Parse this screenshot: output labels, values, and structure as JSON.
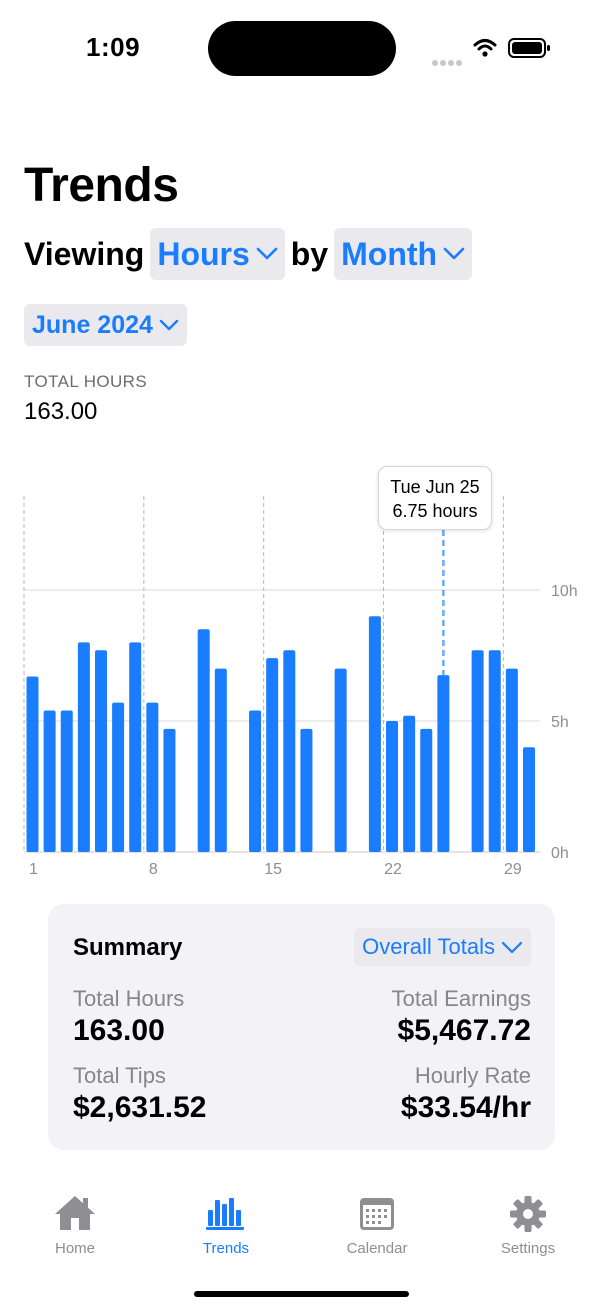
{
  "status_bar": {
    "time": "1:09"
  },
  "header": {
    "title": "Trends",
    "viewing_label": "Viewing",
    "metric": "Hours",
    "by_label": "by",
    "period": "Month",
    "selected_month": "June 2024"
  },
  "total": {
    "label": "TOTAL HOURS",
    "value": "163.00"
  },
  "chart_data": {
    "type": "bar",
    "x_label_ticks": [
      "1",
      "8",
      "15",
      "22",
      "29"
    ],
    "y_ticks": [
      "10h",
      "5h",
      "0h"
    ],
    "ylim": [
      0,
      10
    ],
    "days": [
      1,
      2,
      3,
      4,
      5,
      6,
      7,
      8,
      9,
      11,
      12,
      14,
      15,
      16,
      17,
      19,
      21,
      22,
      23,
      24,
      25,
      27,
      28,
      29,
      30
    ],
    "values": [
      6.7,
      5.4,
      5.4,
      8.0,
      7.7,
      5.7,
      8.0,
      5.7,
      4.7,
      8.5,
      7.0,
      5.4,
      7.4,
      7.7,
      4.7,
      7.0,
      9.0,
      5.0,
      5.2,
      4.7,
      6.75,
      7.7,
      7.7,
      7.0,
      4.0
    ],
    "selected": {
      "day": 25,
      "line1": "Tue Jun 25",
      "line2": "6.75 hours"
    },
    "color": "#1a7cff"
  },
  "summary": {
    "title": "Summary",
    "filter": "Overall Totals",
    "stats": [
      {
        "label": "Total Hours",
        "value": "163.00"
      },
      {
        "label": "Total Earnings",
        "value": "$5,467.72"
      },
      {
        "label": "Total Tips",
        "value": "$2,631.52"
      },
      {
        "label": "Hourly Rate",
        "value": "$33.54/hr"
      }
    ]
  },
  "tabs": [
    {
      "label": "Home",
      "icon": "house-icon"
    },
    {
      "label": "Trends",
      "icon": "chart-bar-icon"
    },
    {
      "label": "Calendar",
      "icon": "calendar-icon"
    },
    {
      "label": "Settings",
      "icon": "gear-icon"
    }
  ],
  "accent_color": "#1a7cff"
}
